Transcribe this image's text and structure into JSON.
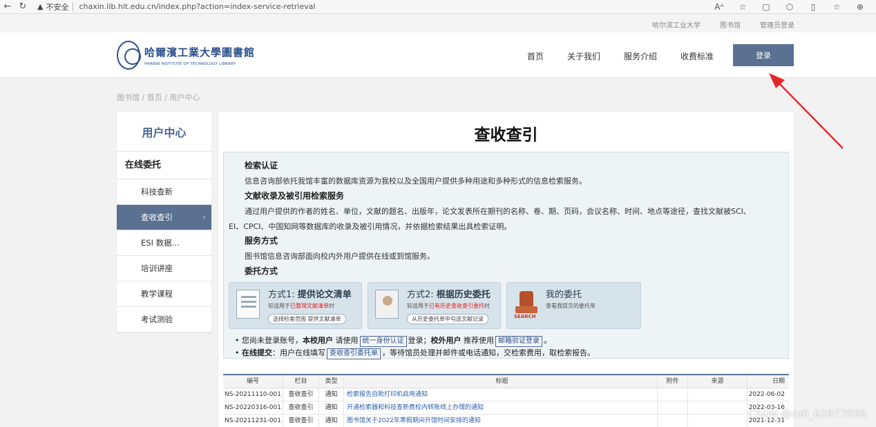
{
  "browser": {
    "back": "←",
    "reload": "↻",
    "home": "⌂",
    "lock": "▲",
    "insecure_label": "不安全",
    "url": "chaxin.lib.hit.edu.cn/index.php?action=index-service-retrieval",
    "tools": [
      "Aᴬ",
      "☆",
      "▢",
      "⬡",
      "▯",
      "☆",
      "⊕"
    ]
  },
  "util_links": [
    "哈尔滨工业大学",
    "图书馆",
    "管理员登录"
  ],
  "logo": {
    "cn": "哈爾濱工業大學圖書館",
    "en": "HARBIN INSTITUTE OF TECHNOLOGY LIBRARY"
  },
  "nav": [
    "首页",
    "关于我们",
    "服务介绍",
    "收费标准"
  ],
  "login_label": "登录",
  "breadcrumb": "图书馆 / 首页 / 用户中心",
  "sidebar": {
    "title": "用户中心",
    "group": "在线委托",
    "items": [
      "科技查新",
      "查收查引",
      "ESI 数据...",
      "培训讲座",
      "教学课程",
      "考试测验"
    ],
    "chevron": "›"
  },
  "main": {
    "title": "查收查引",
    "sections": {
      "s1_h": "检索认证",
      "s1_p": "信息咨询部依托我馆丰富的数据库资源为我校以及全国用户提供多种用途和多种形式的信息检索服务。",
      "s2_h": "文献收录及被引用检索服务",
      "s2_p1": "通过用户提供的作者的姓名、单位，文献的题名、出版年，论文发表所在期刊的名称、卷、期、页码，会议名称、时间、地点等途径，查找文献被SCI、",
      "s2_p2": "EI、CPCI、中国知网等数据库的收录及被引用情况，并依据检索结果出具检索证明。",
      "s3_h": "服务方式",
      "s3_p": "图书馆信息咨询部面向校内外用户提供在线或到馆服务。",
      "s4_h": "委托方式"
    },
    "cards": [
      {
        "t_pre": "方式1: ",
        "t_bold": "提供论文清单",
        "sub_pre": "较适用于",
        "sub_red": "已整理文献清单",
        "sub_post": "时",
        "pill": "选择检索范围 提供文献清单"
      },
      {
        "t_pre": "方式2: ",
        "t_bold": "根据历史委托",
        "sub_pre": "较适用于",
        "sub_red": "已有历史查收查引委托",
        "sub_post": "时",
        "pill": "从历史委托单中勾选文献记录"
      },
      {
        "t_pre": "我的委托",
        "t_bold": "",
        "sub_pre": "查看我提交的委托单",
        "sub_red": "",
        "sub_post": "",
        "pill": "",
        "stamp_word": "SEARCH"
      }
    ],
    "notes": {
      "n1_a": "您尚未登录账号，",
      "n1_b": "本校用户",
      "n1_c": " 请使用",
      "n1_btn1": "统一身份认证",
      "n1_d": "登录；",
      "n1_e": "校外用户",
      "n1_f": " 推荐使用",
      "n1_btn2": "邮箱验证登录",
      "n1_g": "。",
      "n2_a": "在线提交",
      "n2_b": "：用户在线填写",
      "n2_btn": "查收查引委托单",
      "n2_c": "，等待馆员处理并邮件或电话通知，交检索费用，取检索报告。"
    },
    "table": {
      "headers": [
        "编号",
        "栏目",
        "类型",
        "标题",
        "附件",
        "来源",
        "日期"
      ],
      "rows": [
        [
          "NS-20211110-001",
          "查收查引",
          "通知",
          "检索报告自助打印机启用通知",
          "",
          "",
          "2022-06-02"
        ],
        [
          "NS-20220316-001",
          "查收查引",
          "通知",
          "开通检索器和科技查新费校内转账线上办理的通知",
          "",
          "",
          "2022-03-16"
        ],
        [
          "NS-20211231-001",
          "查收查引",
          "通知",
          "图书馆关于2022年寒假期间开馆时间安排的通知",
          "",
          "",
          "2021-12-31"
        ]
      ]
    }
  },
  "watermark": "CSDN @m0_62977030",
  "colors": {
    "accent": "#5a7191",
    "brand": "#2b4f8c",
    "annotation": "#e8262a"
  }
}
